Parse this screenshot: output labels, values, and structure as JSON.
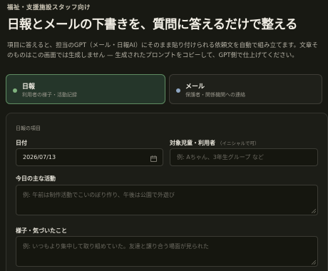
{
  "header": {
    "eyebrow": "福祉・支援施設スタッフ向け",
    "title": "日報とメールの下書きを、質問に答えるだけで整える",
    "description": "項目に答えると、担当のGPT（メール・日報AI）にそのまま貼り付けられる依頼文を自動で組み立てます。文章そのものはこの画面では生成しません — 生成されたプロンプトをコピーして、GPT側で仕上げてください。"
  },
  "modes": [
    {
      "label": "日報",
      "sub": "利用者の様子・活動記録",
      "active": true,
      "dot_color": "#7fb27e"
    },
    {
      "label": "メール",
      "sub": "保護者・関係機関への連絡",
      "active": false,
      "dot_color": "#8fa6c2"
    }
  ],
  "form": {
    "section_title": "日報の項目",
    "date": {
      "label": "日付",
      "value": "2026/07/13"
    },
    "target": {
      "label": "対象児童・利用者",
      "hint": "（イニシャルで可）",
      "placeholder": "例: Aちゃん、3年生グループ など"
    },
    "activity": {
      "label": "今日の主な活動",
      "placeholder": "例: 午前は制作活動でこいのぼり作り、午後は公園で外遊び"
    },
    "notes": {
      "label": "様子・気づいたこと",
      "placeholder": "例: いつもより集中して取り組めていた。友達と譲り合う場面が見られた"
    }
  }
}
